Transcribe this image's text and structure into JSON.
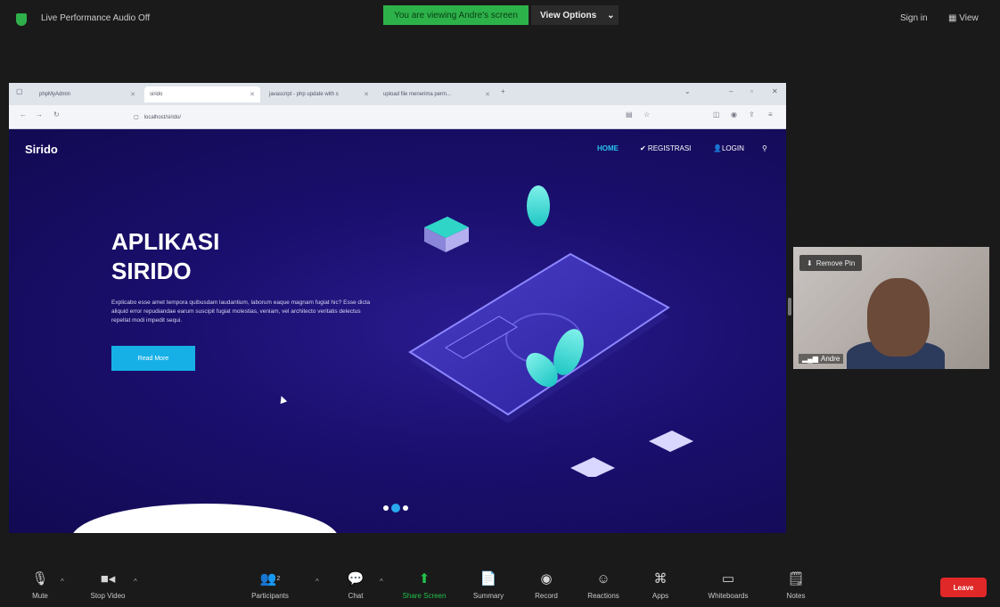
{
  "topbar": {
    "live_audio": "Live Performance Audio Off",
    "viewing_banner": "You are viewing Andre's screen",
    "view_options": "View Options",
    "sign_in": "Sign in",
    "view": "View"
  },
  "browser": {
    "tabs": [
      "phpMyAdmin",
      "sirido",
      "javascript - php update with s",
      "upload file menerima perm..."
    ],
    "url": "localhost/sirido/"
  },
  "site": {
    "brand": "Sirido",
    "menu": {
      "home": "HOME",
      "register": "✔ REGISTRASI",
      "login": "LOGIN"
    },
    "hero_title_1": "APLIKASI",
    "hero_title_2": "SIRIDO",
    "hero_text": "Explicabo esse amet tempora quibusdam laudantium, laborum eaque magnam fugiat hic? Esse dicta aliquid error repudiandae earum suscipit fugiat molestias, veniam, vel architecto veritatis delectus repellat modi impedit sequi.",
    "read_more": "Read More"
  },
  "video": {
    "remove_pin": "Remove Pin",
    "participant_name": "Andre"
  },
  "toolbar": {
    "mute": "Mute",
    "stop_video": "Stop Video",
    "participants": "Participants",
    "participants_count": "2",
    "chat": "Chat",
    "share_screen": "Share Screen",
    "summary": "Summary",
    "record": "Record",
    "reactions": "Reactions",
    "apps": "Apps",
    "whiteboards": "Whiteboards",
    "notes": "Notes",
    "leave": "Leave"
  },
  "colors": {
    "share_green": "#22c14b",
    "leave_red": "#e02828",
    "site_bg": "#1a0f6e",
    "accent_cyan": "#17b0e6"
  }
}
